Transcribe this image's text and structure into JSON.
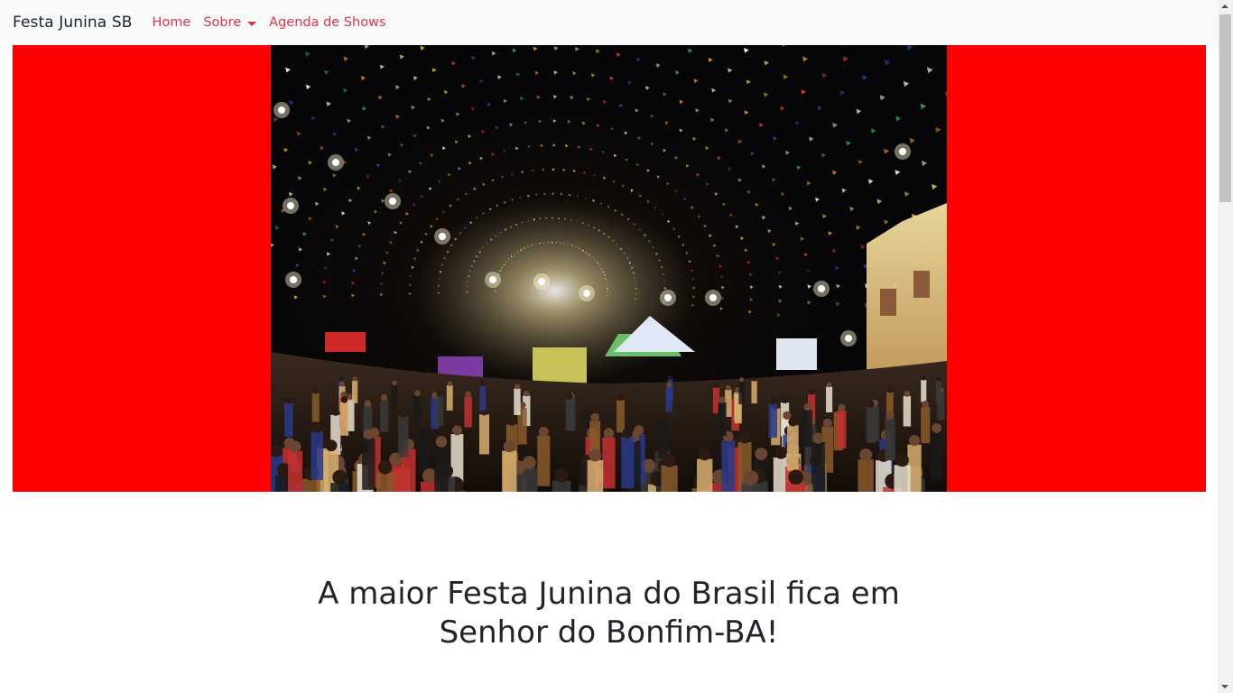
{
  "navbar": {
    "brand": "Festa Junina SB",
    "links": [
      {
        "label": "Home"
      },
      {
        "label": "Sobre",
        "has_dropdown": true
      },
      {
        "label": "Agenda de Shows"
      }
    ],
    "link_color": "#dc3545",
    "background": "#f8f9fa"
  },
  "hero": {
    "background_color": "#ff0000",
    "image": "photo of a crowded festa junina square at night under strings of colorful bandeirinhas flags"
  },
  "main": {
    "headline_line1": "A maior Festa Junina do Brasil fica em",
    "headline_line2": "Senhor do Bonfim-BA!"
  }
}
